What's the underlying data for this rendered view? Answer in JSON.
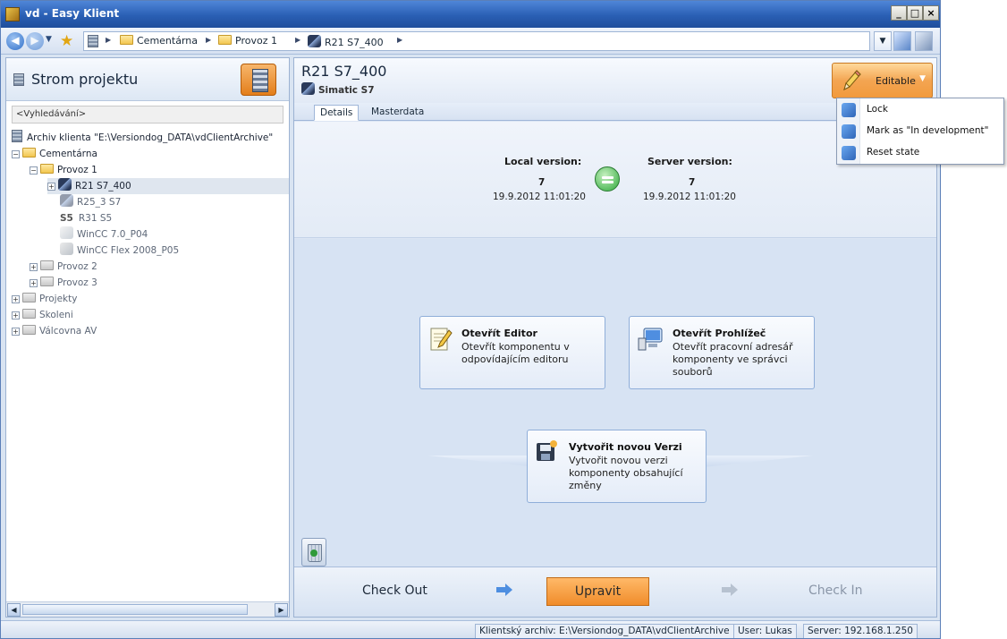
{
  "window": {
    "title": "vd - Easy Klient",
    "minimize": "_",
    "maximize": "□",
    "close": "×"
  },
  "breadcrumb": {
    "items": [
      "Cementárna",
      "Provoz 1",
      "R21 S7_400"
    ]
  },
  "left_pane": {
    "title": "Strom projektu",
    "search_placeholder": "<Vyhledávání>",
    "tree": [
      {
        "label": "Archiv klienta \"E:\\Versiondog_DATA\\vdClientArchive\"",
        "icon": "archive-icon"
      },
      {
        "label": "Cementárna",
        "icon": "folder-open-icon"
      },
      {
        "label": "Provoz 1",
        "icon": "folder-open-icon"
      },
      {
        "label": "R21 S7_400",
        "icon": "simatic-s7-icon",
        "selected": true
      },
      {
        "label": "R25_3 S7",
        "icon": "simatic-s7-icon"
      },
      {
        "label": "R31 S5",
        "icon": "s5-icon",
        "badge": "S5"
      },
      {
        "label": "WinCC 7.0_P04",
        "icon": "wincc-icon"
      },
      {
        "label": "WinCC Flex 2008_P05",
        "icon": "wincc-flex-icon"
      },
      {
        "label": "Provoz 2",
        "icon": "folder-icon"
      },
      {
        "label": "Provoz 3",
        "icon": "folder-icon"
      },
      {
        "label": "Projekty",
        "icon": "folder-icon"
      },
      {
        "label": "Skoleni",
        "icon": "folder-icon"
      },
      {
        "label": "Válcovna AV",
        "icon": "folder-icon"
      }
    ]
  },
  "component": {
    "title": "R21 S7_400",
    "subtitle": "Simatic S7",
    "state_button": "Editable"
  },
  "tabs": [
    "Details",
    "Masterdata"
  ],
  "versions": {
    "local_label": "Local version:",
    "local_number": "7",
    "local_date": "19.9.2012 11:01:20",
    "server_label": "Server version:",
    "server_number": "7",
    "server_date": "19.9.2012 11:01:20"
  },
  "actions": {
    "editor": {
      "title": "Otevřít Editor",
      "desc": "Otevřít komponentu v odpovídajícím editoru"
    },
    "browser": {
      "title": "Otevřít Prohlížeč",
      "desc": "Otevřít pracovní adresář komponenty ve správci souborů"
    },
    "new_version": {
      "title": "Vytvořit novou Verzi",
      "desc": "Vytvořit novou verzi komponenty obsahující změny"
    }
  },
  "workflow": {
    "check_out": "Check Out",
    "edit": "Upravit",
    "check_in": "Check In"
  },
  "menu": {
    "items": [
      "Lock",
      "Mark as \"In development\"",
      "Reset state"
    ]
  },
  "status_bar": {
    "archive": "Klientský archiv: E:\\Versiondog_DATA\\vdClientArchive",
    "user": "User: Lukas",
    "server": "Server: 192.168.1.250"
  },
  "colors": {
    "accent_orange": "#f3a552",
    "title_bar_blue": "#2a5fb4",
    "panel_blue": "#dce6f4",
    "status_green": "#2ea83a"
  }
}
